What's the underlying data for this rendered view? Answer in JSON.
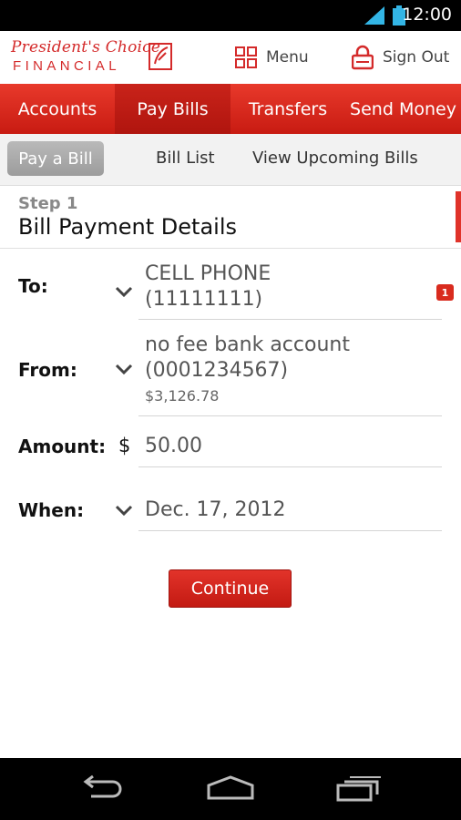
{
  "status_bar": {
    "time": "12:00"
  },
  "header": {
    "logo_script": "President's Choice",
    "logo_word": "FINANCIAL",
    "menu_label": "Menu",
    "signout_label": "Sign Out"
  },
  "main_nav": {
    "tabs": [
      {
        "label": "Accounts"
      },
      {
        "label": "Pay Bills"
      },
      {
        "label": "Transfers"
      },
      {
        "label": "Send Money"
      }
    ],
    "active": "Pay Bills"
  },
  "sub_nav": {
    "pay_bill": "Pay a Bill",
    "bill_list": "Bill List",
    "upcoming": "View Upcoming Bills",
    "badge_count": "1"
  },
  "step": {
    "step_label": "Step 1",
    "title": "Bill Payment Details"
  },
  "form": {
    "to_label": "To:",
    "to_line1": "CELL PHONE",
    "to_line2": "(11111111)",
    "from_label": "From:",
    "from_line1": "no fee bank account",
    "from_line2": "(0001234567)",
    "from_balance": "$3,126.78",
    "amount_label": "Amount:",
    "currency": "$",
    "amount_value": "50.00",
    "when_label": "When:",
    "when_value": "Dec. 17, 2012",
    "continue_label": "Continue"
  },
  "colors": {
    "brand_red": "#d42a2a",
    "nav_red": "#c81b12"
  }
}
